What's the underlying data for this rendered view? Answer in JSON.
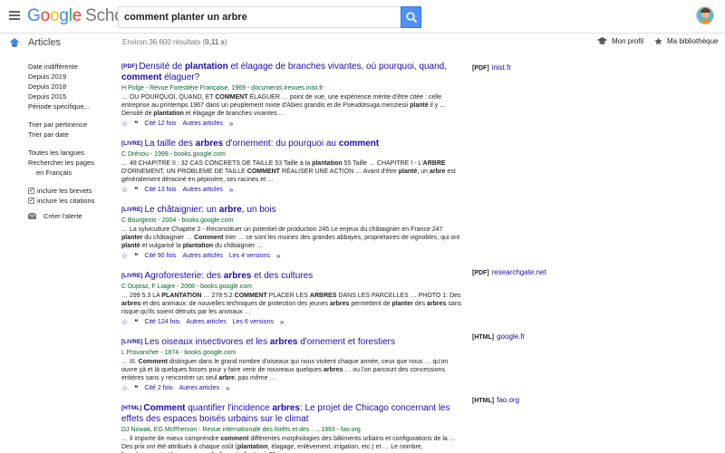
{
  "header": {
    "logo_letters": [
      "G",
      "o",
      "o",
      "g",
      "l",
      "e"
    ],
    "logo_scholar": "Scholar",
    "search_value": "comment planter un arbre"
  },
  "subhead": {
    "section_label": "Articles",
    "results_prefix": "Environ 36 600 résultats (",
    "results_time": "0,11 s",
    "results_suffix": ")",
    "profile_label": "Mon profil",
    "library_label": "Ma bibliothèque"
  },
  "sidebar": {
    "date_any": "Date indifférente",
    "date_2019": "Depuis 2019",
    "date_2018": "Depuis 2018",
    "date_2015": "Depuis 2015",
    "date_custom": "Période spécifique...",
    "sort_relevance": "Trier par pertinence",
    "sort_date": "Trier par date",
    "lang_all": "Toutes les langues",
    "lang_fr_1": "Rechercher les pages",
    "lang_fr_2": "en Français",
    "include_patents": "inclure les brevets",
    "include_citations": "inclure les citations",
    "create_alert": "Créer l'alerte"
  },
  "results": [
    {
      "tag": "[PDF]",
      "title_html": "Densité de <b>plantation</b> et élagage de branches vivantes, où pourquoi, quand, <b>comment</b> élaguer?",
      "meta": "H Polge - Revue Forestière Française, 1969 - documents.irevues.inist.fr",
      "snippet_html": "… OU POURQUOI, QUAND, ET <b>COMMENT</b> ÉLAGUER … point de vue, une expérience mérite d'être citée : celle entreprise au printemps 1967 dans un peuplement mixte d'Abies grandis et de Pseudotsuga menziesii <b>planté</b> il y … Densité de <b>plantation</b> et élagage de branches vivantes …",
      "cited": "Cité 12 fois",
      "versions": "Autres articles",
      "all_versions": ""
    },
    {
      "tag": "[LIVRE]",
      "title_html": "La taille des <b>arbres</b> d'ornement: du pourquoi au <b>comment</b>",
      "meta": "C Drénou - 1999 - books.google.com",
      "snippet_html": "… 48 CHAPITRE II : 32 CAS CONCRETS DE TAILLE 53 Taille à la <b>plantation</b> 55 Taille … CHAPITRE I - L'<b>ARBRE</b> D'ORNEMENT, UN PROBLEME DE TAILLE <b>COMMENT</b> RÉALISER UNE ACTION … Avant d'être <b>planté</b>, un <b>arbre</b> est généralement déraciné en pépinière, ses racines et …",
      "cited": "Cité 13 fois",
      "versions": "Autres articles",
      "all_versions": ""
    },
    {
      "tag": "[LIVRE]",
      "title_html": "Le châtaignier: un <b>arbre</b>, un bois",
      "meta": "C Bourgeois - 2004 - books.google.com",
      "snippet_html": "… La sylviculture Chapitre 2 - Reconstituer un potentiel de production 245 Le enjeux du châtaignier en France 247 <b>planter</b> du châtaignier … <b>Comment</b> trier … ce sont les moines des grandes abbayes, propriétaires de vignobles, qui ont <b>planté</b> et vulgarisé la <b>plantation</b> du châtaignier …",
      "cited": "Cité 90 fois",
      "versions": "Autres articles",
      "all_versions": "Les 4 versions"
    },
    {
      "tag": "[LIVRE]",
      "title_html": "Agroforesterie: des <b>arbres</b> et des cultures",
      "meta": "C Dupraz, F Liagre - 2008 - books.google.com",
      "snippet_html": "… 299 5.3 LA <b>PLANTATION</b> … 278 5.2 <b>COMMENT</b> PLACER LES <b>ARBRES</b> DANS LES PARCELLES … PHOTO 1: Des <b>arbres</b> et des animaux: de nouvelles techniques de protection des jeunes <b>arbres</b> permettent de <b>planter</b> des <b>arbres</b> sans risque qu'ils soient détruits par les animaux …",
      "cited": "Cité 124 fois",
      "versions": "Autres articles",
      "all_versions": "Les 6 versions"
    },
    {
      "tag": "[LIVRE]",
      "title_html": "Les oiseaux insectivores et les <b>arbres</b> d'ornement et forestiers",
      "meta": "L Provancher - 1874 - books.google.com",
      "snippet_html": "… III. <b>Comment</b> distinguer dans le grand nombre d'oiseaux qui nous visitent chaque année, ceux que nous … qu'on ouvre çà et là quelques fosses pour y faire venir de nouveaux quelques <b>arbres</b> … ou l'on parcourt des concessions entières sans y rencontrer un seul <b>arbre</b>, pas même …",
      "cited": "Cité 2 fois",
      "versions": "Autres articles",
      "all_versions": ""
    },
    {
      "tag": "[HTML]",
      "title_html": "<b>Comment</b> quantifier l'incidence <b>arbres</b>: Le projet de Chicago concernant les effets des espaces boisés urbains sur le climat",
      "meta": "DJ Nowak, EG McPherson - Revue internationale des forêts et des …, 1993 - fao.org",
      "snippet_html": "… Il importe de mieux comprendre <b>comment</b> différentes morphologies des bâtiments urbains et configurations de la … Des prix ont été attribués à chaque coût (<b>plantation</b>, élagage, enlèvement, irrigation, etc.) et … Le nombre, l'emplacement et les essences d'<b>arbres</b> à <b>planter</b> à Chicago …",
      "cited": "",
      "versions": "",
      "all_versions": ""
    }
  ],
  "side_links": [
    {
      "tag": "[PDF]",
      "label": "inist.fr"
    },
    {
      "tag": "[PDF]",
      "label": "researchgate.net"
    },
    {
      "tag": "[HTML]",
      "label": "google.fr"
    },
    {
      "tag": "[HTML]",
      "label": "fao.org"
    }
  ],
  "colors": {
    "link": "#1a0dab",
    "meta_green": "#006621",
    "filter_red": "#dd4b39",
    "search_blue": "#4d90fe"
  }
}
